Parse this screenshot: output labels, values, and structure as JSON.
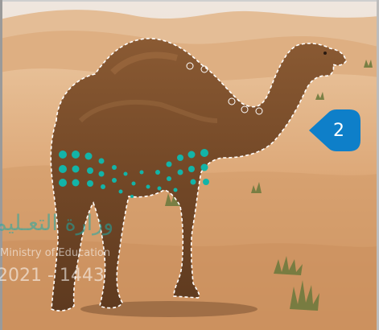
{
  "badge": {
    "number": "2",
    "color": "#0e7fc9"
  },
  "watermark": {
    "arabic": "وزارة التعـليم",
    "english": "Ministry of Education",
    "year": "2021 - 1443",
    "dots_color": "#13b4a8"
  },
  "photo": {
    "subject_icon": "camel-selection-icon"
  },
  "colors": {
    "sand_light": "#e2b78c",
    "sand_mid": "#d79e6a",
    "camel": "#7a4e2c"
  }
}
